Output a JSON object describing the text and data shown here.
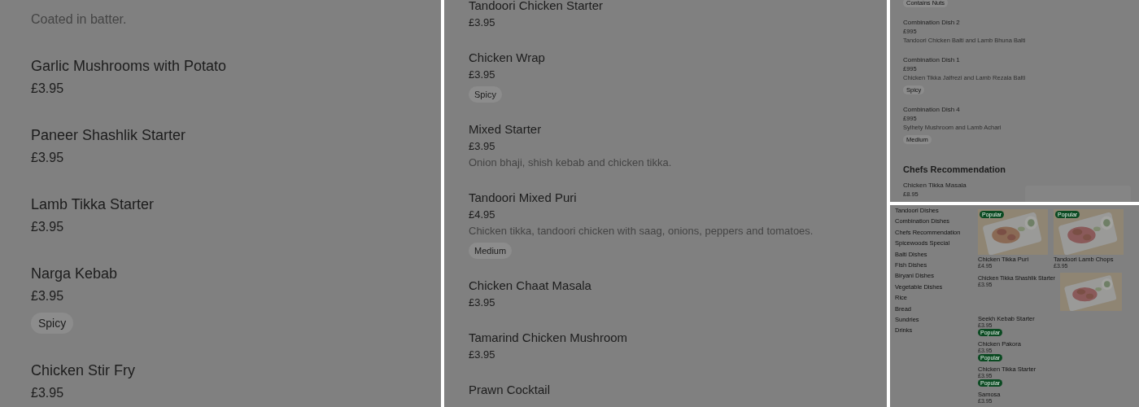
{
  "left_panel": {
    "items": [
      {
        "description": "Coated in batter."
      },
      {
        "title": "Garlic Mushrooms with Potato",
        "price": "£3.95"
      },
      {
        "title": "Paneer Shashlik Starter",
        "price": "£3.95"
      },
      {
        "title": "Lamb Tikka Starter",
        "price": "£3.95"
      },
      {
        "title": "Narga Kebab",
        "price": "£3.95",
        "tag": "Spicy"
      },
      {
        "title": "Chicken Stir Fry",
        "price": "£3.95"
      }
    ]
  },
  "middle_panel": {
    "items": [
      {
        "title": "Tandoori Chicken Starter",
        "price": "£3.95"
      },
      {
        "title": "Chicken Wrap",
        "price": "£3.95",
        "tag": "Spicy"
      },
      {
        "title": "Mixed Starter",
        "price": "£3.95",
        "description": "Onion bhaji, shish kebab and chicken tikka."
      },
      {
        "title": "Tandoori Mixed Puri",
        "price": "£4.95",
        "description": "Chicken tikka, tandoori chicken with saag, onions, peppers and tomatoes.",
        "tag": "Medium"
      },
      {
        "title": "Chicken Chaat Masala",
        "price": "£3.95"
      },
      {
        "title": "Tamarind Chicken Mushroom",
        "price": "£3.95"
      },
      {
        "title": "Prawn Cocktail"
      }
    ]
  },
  "right_top_panel": {
    "items": [
      {
        "tag": "Contains Nuts"
      },
      {
        "title": "Combination Dish 2",
        "price": "£995",
        "description": "Tandoori Chicken Balti and Lamb Bhuna Balti"
      },
      {
        "title": "Combination Dish 1",
        "price": "£995",
        "description": "Chicken Tikka Jalfrezi and Lamb Rezala Balti",
        "tag": "Spicy"
      },
      {
        "title": "Combination Dish 4",
        "price": "£995",
        "description": "Sylhety Mushroom and Lamb Achari",
        "tag": "Medium"
      }
    ],
    "section_heading": "Chefs Recommendation",
    "section_items": [
      {
        "title": "Chicken Tikka Masala",
        "price": "£8.95"
      }
    ]
  },
  "right_bottom_panel": {
    "categories": [
      "Tandoori Dishes",
      "Combination Dishes",
      "Chefs Recommendation",
      "Spicewoods Special",
      "Balti Dishes",
      "Fish Dishes",
      "Biryani Dishes",
      "Vegetable Dishes",
      "Rice",
      "Bread",
      "Sundries",
      "Drinks"
    ],
    "items": [
      {
        "kind": "card",
        "title": "Chicken Tikka Puri",
        "price": "£4.95",
        "badge": "Popular"
      },
      {
        "kind": "card",
        "title": "Tandoori Lamb Chops",
        "price": "£3.95",
        "badge": "Popular"
      },
      {
        "kind": "row",
        "title": "Chicken Tikka Shashlik Starter",
        "price": "£3.95"
      },
      {
        "kind": "plain",
        "title": "Seekh Kebab Starter",
        "price": "£3.95",
        "badge": "Popular"
      },
      {
        "kind": "plain",
        "title": "Chicken Pakora",
        "price": "£3.95",
        "badge": "Popular"
      },
      {
        "kind": "plain",
        "title": "Chicken Tikka Starter",
        "price": "£3.95",
        "badge": "Popular"
      },
      {
        "kind": "plain",
        "title": "Samosa",
        "price": "£3.95"
      }
    ]
  }
}
